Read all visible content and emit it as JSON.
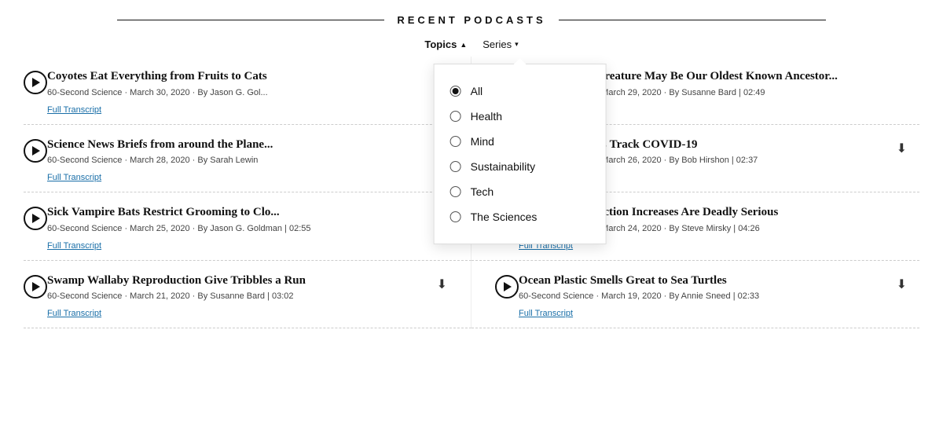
{
  "header": {
    "title": "RECENT PODCASTS"
  },
  "filters": {
    "topics_label": "Topics",
    "series_label": "Series",
    "topics_arrow": "▲",
    "series_arrow": "▾",
    "dropdown_items": [
      {
        "label": "All",
        "selected": true
      },
      {
        "label": "Health",
        "selected": false
      },
      {
        "label": "Mind",
        "selected": false
      },
      {
        "label": "Sustainability",
        "selected": false
      },
      {
        "label": "Tech",
        "selected": false
      },
      {
        "label": "The Sciences",
        "selected": false
      }
    ]
  },
  "podcasts": [
    {
      "title": "Coyotes Eat Everything from Fruits to Cats",
      "series": "60-Second Science",
      "date": "March 30, 2020",
      "author": "Jason G. Gol...",
      "duration": null,
      "has_transcript": true,
      "has_download": false
    },
    {
      "title": "...ny Wormlike Creature May Be Our Oldest Known Ancestor...",
      "series": "60-Second Science",
      "date": "March 29, 2020",
      "author": "Susanne Bard",
      "duration": "02:49",
      "has_transcript": true,
      "has_download": false
    },
    {
      "title": "Science News Briefs from around the Plane...",
      "series": "60-Second Science",
      "date": "March 28, 2020",
      "author": "Sarah Lewin",
      "duration": null,
      "has_transcript": true,
      "has_download": false
    },
    {
      "title": "...elp Researchers Track COVID-19",
      "series": "60-Second Science",
      "date": "March 26, 2020",
      "author": "Bob Hirshon",
      "duration": "02:37",
      "has_transcript": true,
      "has_download": true
    },
    {
      "title": "Sick Vampire Bats Restrict Grooming to Clo...",
      "series": "60-Second Science",
      "date": "March 25, 2020",
      "author": "Jason G. Goldman",
      "duration": "02:55",
      "has_transcript": true,
      "has_download": true
    },
    {
      "title": "...xponential Infection Increases Are Deadly Serious",
      "series": "60-Second Science",
      "date": "March 24, 2020",
      "author": "Steve Mirsky",
      "duration": "04:26",
      "has_transcript": true,
      "has_download": false
    },
    {
      "title": "Swamp Wallaby Reproduction Give Tribbles a Run",
      "series": "60-Second Science",
      "date": "March 21, 2020",
      "author": "Susanne Bard",
      "duration": "03:02",
      "has_transcript": true,
      "has_download": true
    },
    {
      "title": "Ocean Plastic Smells Great to Sea Turtles",
      "series": "60-Second Science",
      "date": "March 19, 2020",
      "author": "Annie Sneed",
      "duration": "02:33",
      "has_transcript": true,
      "has_download": true
    }
  ],
  "labels": {
    "full_transcript": "Full Transcript",
    "separator": "·"
  }
}
